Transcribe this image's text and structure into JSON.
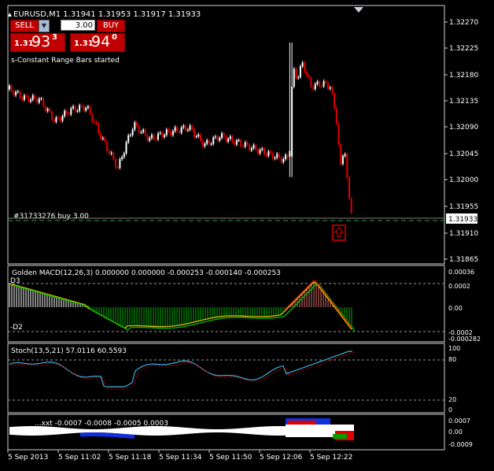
{
  "header": {
    "title": "EURUSD,M1  1.31941 1.31953 1.31917 1.31933",
    "status": "s-Constant Range Bars started"
  },
  "trade_panel": {
    "sell_label": "SELL",
    "buy_label": "BUY",
    "lot_value": "3.00",
    "sell_price": {
      "big": "1.31",
      "main": "93",
      "sup": "3"
    },
    "buy_price": {
      "big": "1.31",
      "main": "94",
      "sup": "0"
    }
  },
  "main_axis": {
    "labels": [
      "1.32270",
      "1.32225",
      "1.32180",
      "1.32135",
      "1.32090",
      "1.32045",
      "1.32000",
      "1.31955",
      "1.31910",
      "1.31865"
    ],
    "current_price": "1.31933"
  },
  "order_line": {
    "label": "#31733276 buy 3.00"
  },
  "macd": {
    "title": "Golden MACD(12,26,3) 0.000000 0.000000 -0.000253 -0.000140 -0.000253",
    "level_top": "D3",
    "level_bottom": "-D2",
    "axis": [
      "0.00036",
      "0.0002",
      "0.00",
      "-0.0002",
      "-0.000282"
    ]
  },
  "stoch": {
    "title": "Stoch(13,5,21) 57.0116 60.5593",
    "axis": [
      "100",
      "80",
      "20",
      "0"
    ]
  },
  "bottom_indicator": {
    "title": "...xxt -0.0007 -0.0008 -0.0005 0.0003",
    "axis": [
      "0.0007",
      "0.00",
      "-0.0009"
    ]
  },
  "time_axis": [
    "5 Sep 2013",
    "5 Sep 11:02",
    "5 Sep 11:18",
    "5 Sep 11:34",
    "5 Sep 11:50",
    "5 Sep 12:06",
    "5 Sep 12:22"
  ],
  "colors": {
    "bull": "#ffffff",
    "bear": "#e00000",
    "signal": "#00c000",
    "macd_line": "#e8c000",
    "accent_red": "#c00000"
  },
  "icons": {
    "order_marker": "up-arrow-icon",
    "lot_down": "triangle-down-icon",
    "lot_up": "triangle-up-icon"
  }
}
